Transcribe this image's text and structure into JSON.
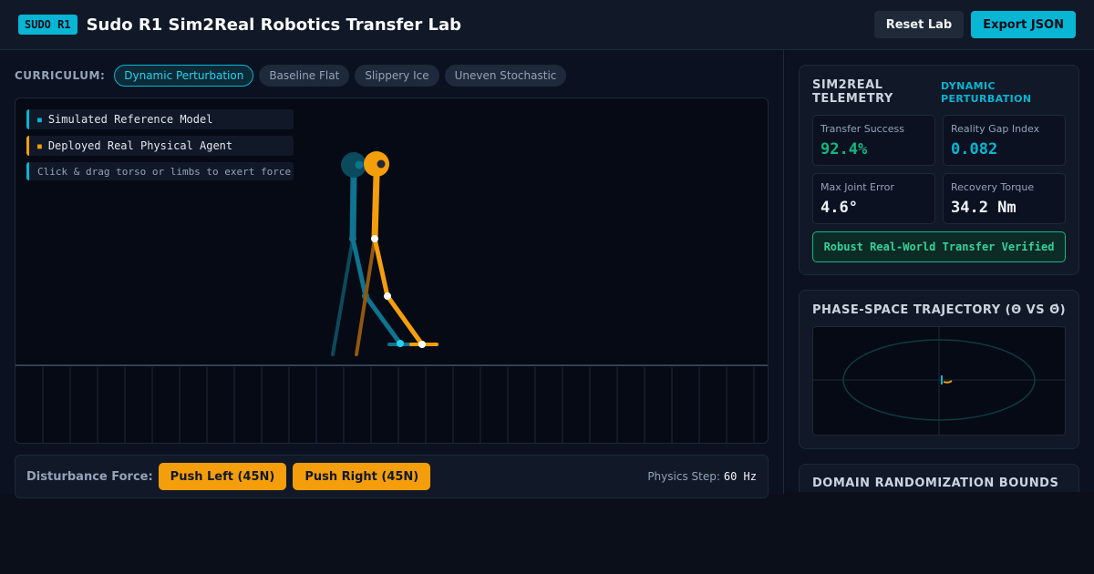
{
  "header": {
    "badge": "SUDO R1",
    "title": "Sudo R1 Sim2Real Robotics Transfer Lab",
    "reset_label": "Reset Lab",
    "export_label": "Export JSON"
  },
  "curriculum": {
    "label": "CURRICULUM:",
    "options": [
      "Dynamic Perturbation",
      "Baseline Flat",
      "Slippery Ice",
      "Uneven Stochastic"
    ],
    "selected": "Dynamic Perturbation"
  },
  "sim": {
    "legend": {
      "sim_model": "Simulated Reference Model",
      "real_agent": "Deployed Real Physical Agent",
      "hint": "Click & drag torso or limbs to exert force"
    },
    "legend_glyph": "■",
    "colors": {
      "sim": "#06b6d4",
      "real": "#f59e0b"
    }
  },
  "disturbance": {
    "label": "Disturbance Force:",
    "push_left": "Push Left (45N)",
    "push_right": "Push Right (45N)",
    "physics_label": "Physics Step:",
    "physics_value": "60 Hz"
  },
  "telemetry": {
    "title": "SIM2REAL TELEMETRY",
    "mode_tag": "DYNAMIC PERTURBATION",
    "transfer_success": {
      "label": "Transfer Success",
      "value": "92.4%",
      "color": "#10b981"
    },
    "reality_gap": {
      "label": "Reality Gap Index",
      "value": "0.082",
      "color": "#06b6d4"
    },
    "max_joint_error": {
      "label": "Max Joint Error",
      "value": "4.6°"
    },
    "recovery_torque": {
      "label": "Recovery Torque",
      "value": "34.2 Nm"
    },
    "status": "Robust Real-World Transfer Verified"
  },
  "phase": {
    "title": "PHASE-SPACE TRAJECTORY (Θ VS Θ̇)"
  },
  "domain": {
    "title": "DOMAIN RANDOMIZATION BOUNDS"
  }
}
